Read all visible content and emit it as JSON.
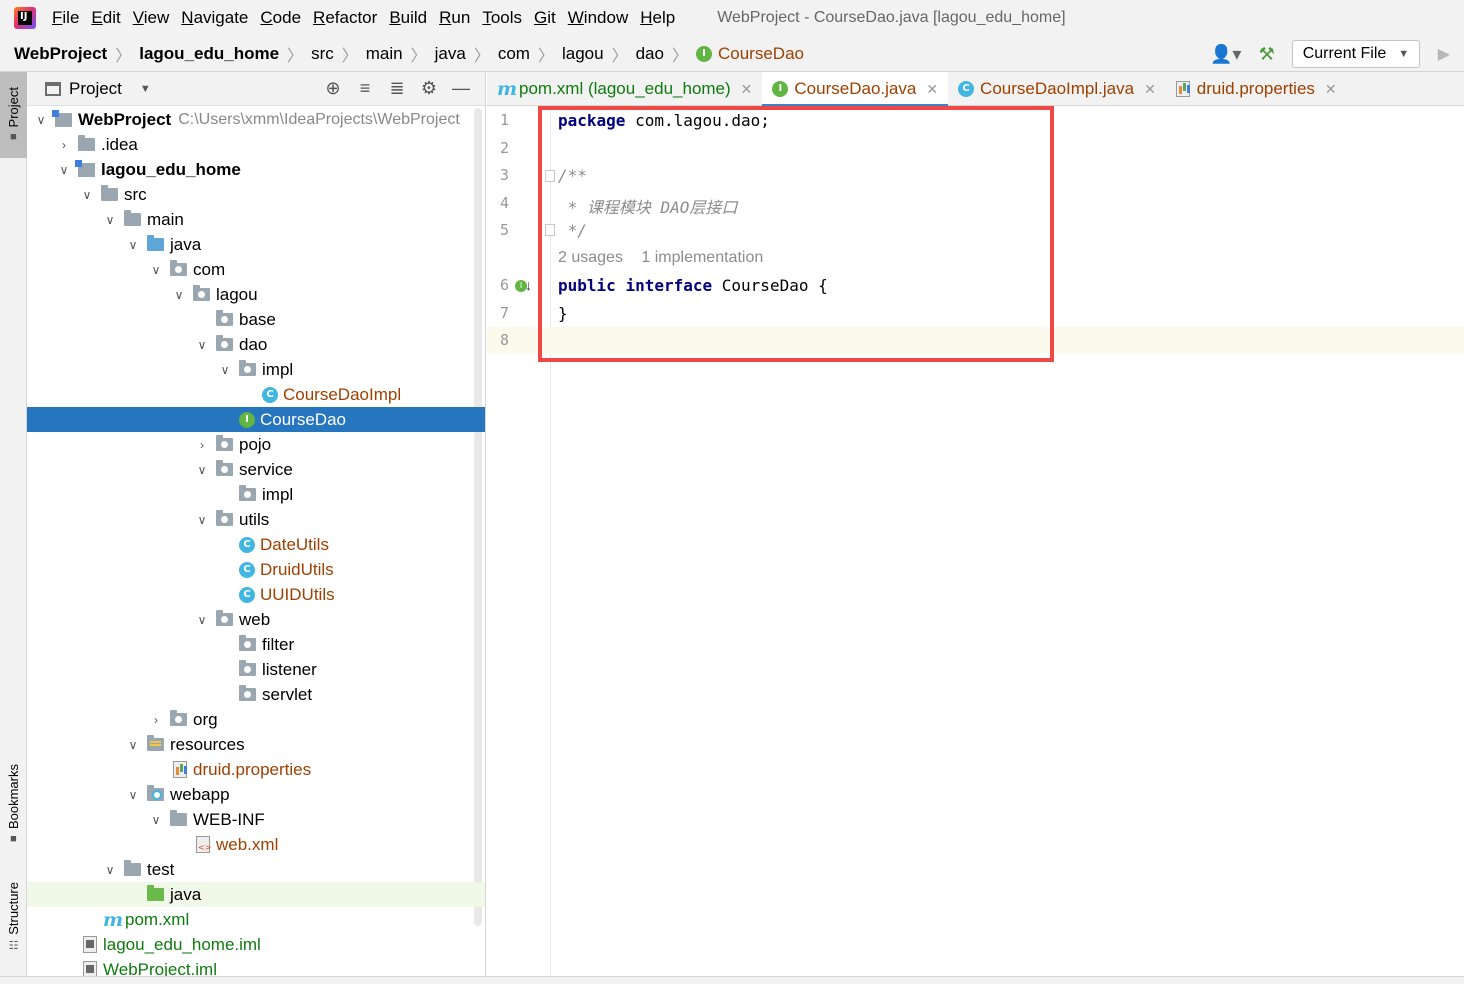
{
  "menubar": {
    "items": [
      {
        "mnemonic": "F",
        "rest": "ile"
      },
      {
        "mnemonic": "E",
        "rest": "dit"
      },
      {
        "mnemonic": "V",
        "rest": "iew"
      },
      {
        "mnemonic": "N",
        "rest": "avigate"
      },
      {
        "mnemonic": "C",
        "rest": "ode"
      },
      {
        "mnemonic": "R",
        "rest": "efactor"
      },
      {
        "mnemonic": "B",
        "rest": "uild"
      },
      {
        "mnemonic": "R",
        "rest": "un"
      },
      {
        "mnemonic": "T",
        "rest": "ools"
      },
      {
        "mnemonic": "G",
        "rest": "it"
      },
      {
        "mnemonic": "W",
        "rest": "indow"
      },
      {
        "mnemonic": "H",
        "rest": "elp"
      }
    ],
    "window_title": "WebProject - CourseDao.java [lagou_edu_home]"
  },
  "breadcrumb": {
    "items": [
      "WebProject",
      "lagou_edu_home",
      "src",
      "main",
      "java",
      "com",
      "lagou",
      "dao"
    ],
    "current": "CourseDao",
    "current_icon": "I"
  },
  "toolbar": {
    "run_config": "Current File"
  },
  "left_stripe": {
    "project": "Project",
    "bookmarks": "Bookmarks",
    "structure": "Structure"
  },
  "project_panel": {
    "title": "Project",
    "tree": [
      {
        "label": "WebProject",
        "path": "C:\\Users\\xmm\\IdeaProjects\\WebProject"
      },
      {
        "label": ".idea"
      },
      {
        "label": "lagou_edu_home"
      },
      {
        "label": "src"
      },
      {
        "label": "main"
      },
      {
        "label": "java"
      },
      {
        "label": "com"
      },
      {
        "label": "lagou"
      },
      {
        "label": "base"
      },
      {
        "label": "dao"
      },
      {
        "label": "impl"
      },
      {
        "label": "CourseDaoImpl",
        "icon": "C"
      },
      {
        "label": "CourseDao",
        "icon": "I"
      },
      {
        "label": "pojo"
      },
      {
        "label": "service"
      },
      {
        "label": "impl"
      },
      {
        "label": "utils"
      },
      {
        "label": "DateUtils",
        "icon": "C"
      },
      {
        "label": "DruidUtils",
        "icon": "C"
      },
      {
        "label": "UUIDUtils",
        "icon": "C"
      },
      {
        "label": "web"
      },
      {
        "label": "filter"
      },
      {
        "label": "listener"
      },
      {
        "label": "servlet"
      },
      {
        "label": "org"
      },
      {
        "label": "resources"
      },
      {
        "label": "druid.properties"
      },
      {
        "label": "webapp"
      },
      {
        "label": "WEB-INF"
      },
      {
        "label": "web.xml"
      },
      {
        "label": "test"
      },
      {
        "label": "java"
      },
      {
        "label": "pom.xml",
        "icon": "m"
      },
      {
        "label": "lagou_edu_home.iml"
      },
      {
        "label": "WebProject.iml"
      }
    ]
  },
  "editor_tabs": [
    {
      "label": "pom.xml (lagou_edu_home)",
      "icon": "m"
    },
    {
      "label": "CourseDao.java",
      "icon": "I"
    },
    {
      "label": "CourseDaoImpl.java",
      "icon": "C"
    },
    {
      "label": "druid.properties"
    }
  ],
  "editor": {
    "line_numbers": [
      "1",
      "2",
      "3",
      "4",
      "5",
      "6",
      "7",
      "8"
    ],
    "line1": {
      "kw": "package",
      "rest": " com.lagou.dao;"
    },
    "line3": "/**",
    "line4": " * 课程模块 DAO层接口",
    "line5": " */",
    "hint_usages": "2 usages",
    "hint_impl": "1 implementation",
    "line6": {
      "kw1": "public",
      "kw2": "interface",
      "rest": " CourseDao {"
    },
    "line7": "}",
    "impl_marker": "I"
  },
  "colors": {
    "selection": "#2675bf",
    "accent": "#4083c9",
    "highlight_box": "#f04747",
    "keyword": "#000080",
    "comment": "#8c8c8c",
    "interface_icon": "#62b543",
    "class_icon": "#40b6e0"
  }
}
